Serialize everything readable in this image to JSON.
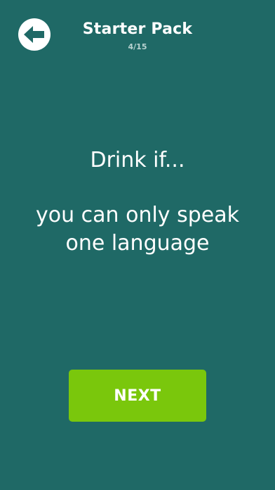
{
  "header": {
    "title": "Starter Pack",
    "counter": "4/15",
    "back_icon": "arrow-left-icon"
  },
  "card": {
    "prompt": "Drink if...",
    "statement_line1": "you can only speak",
    "statement_line2": "one language"
  },
  "actions": {
    "next_label": "NEXT"
  },
  "colors": {
    "background": "#1f6966",
    "next_button": "#7ac70c",
    "text": "#ffffff",
    "counter_text": "#b9d3d1"
  }
}
